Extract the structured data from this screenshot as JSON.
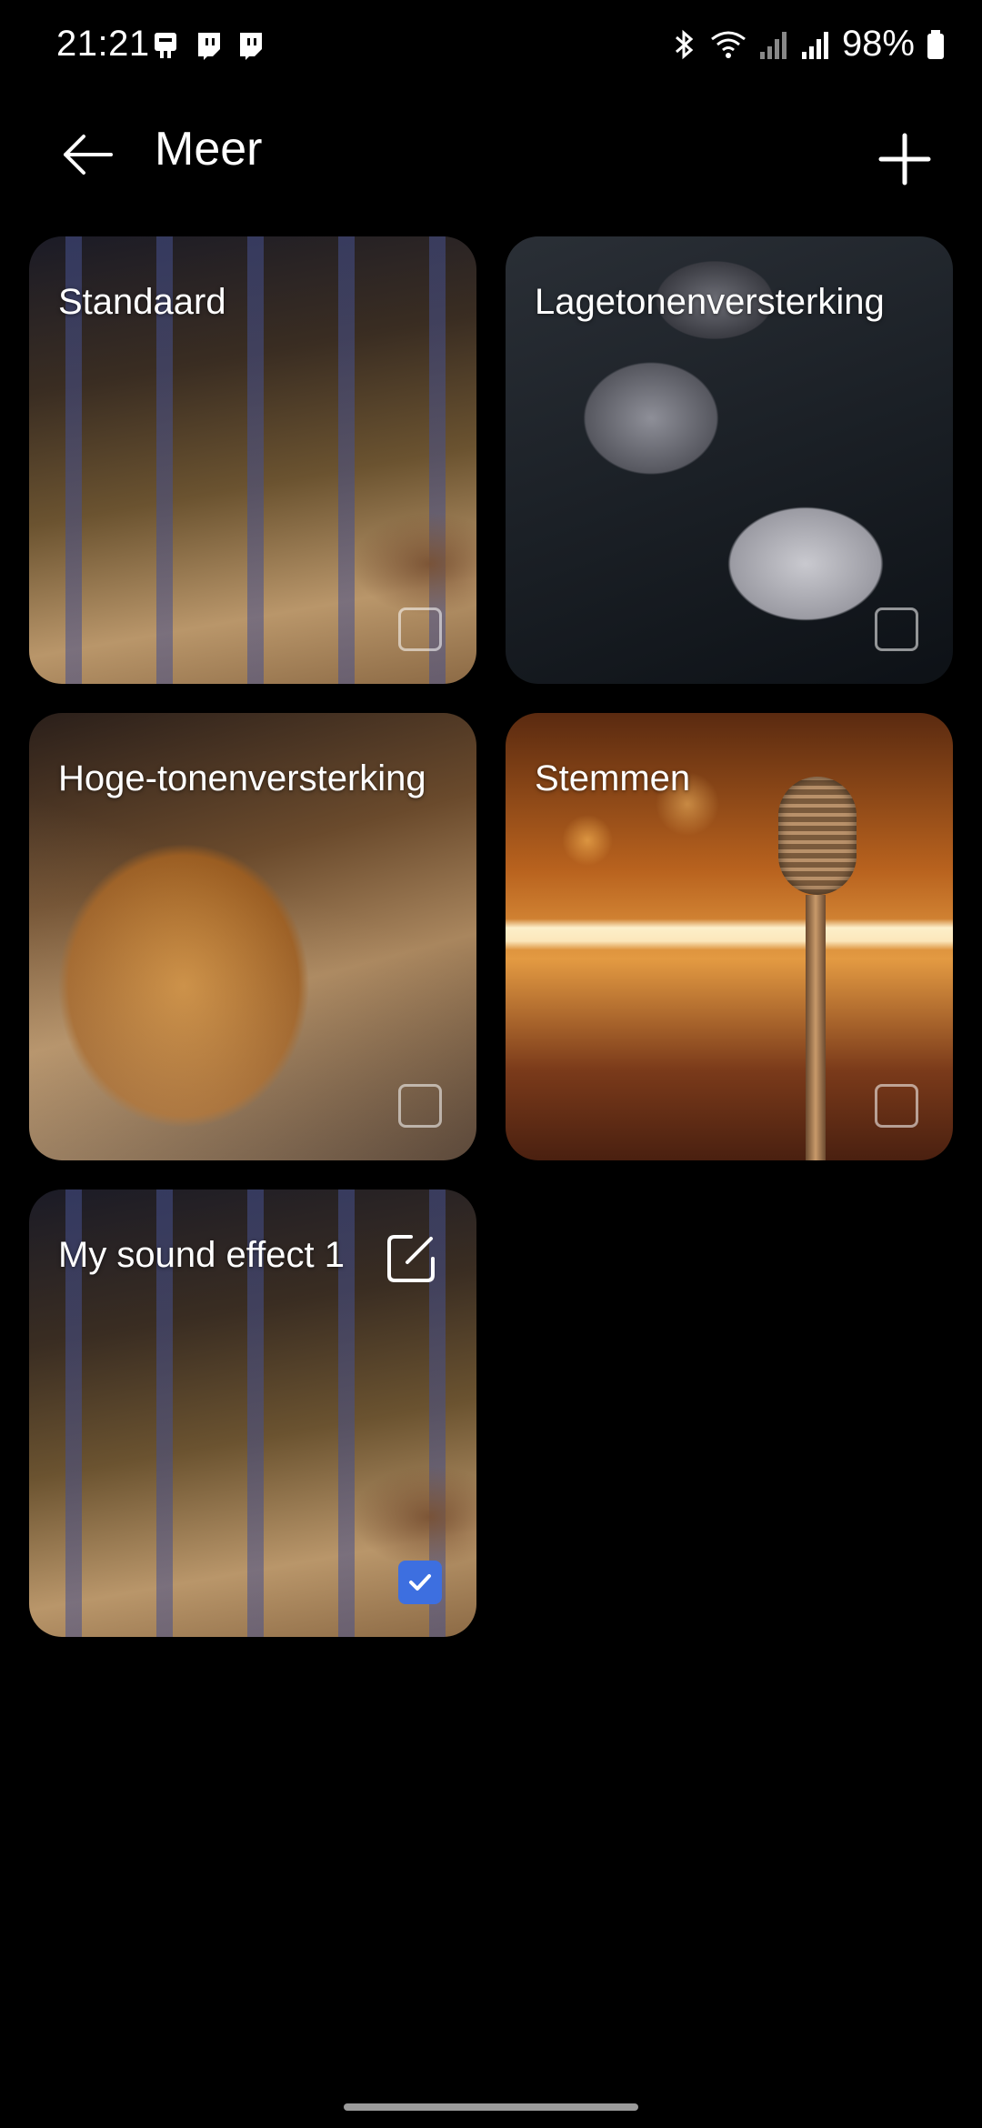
{
  "status_bar": {
    "time": "21:21",
    "battery": "98%",
    "icons": [
      "notification-icon",
      "twitch-icon",
      "twitch-icon",
      "bluetooth-icon",
      "wifi-icon",
      "signal-icon",
      "signal-icon",
      "battery-icon"
    ]
  },
  "app_bar": {
    "title": "Meer",
    "back_icon": "back-arrow-icon",
    "add_icon": "plus-icon"
  },
  "cards": [
    {
      "label": "Standaard",
      "checked": false
    },
    {
      "label": "Lagetonenversterking",
      "checked": false
    },
    {
      "label": "Hoge-tonenversterking",
      "checked": false
    },
    {
      "label": "Stemmen",
      "checked": false
    },
    {
      "label": "My sound effect 1",
      "checked": true,
      "editable": true
    }
  ],
  "colors": {
    "background": "#000000",
    "accent": "#3d6fe0"
  }
}
